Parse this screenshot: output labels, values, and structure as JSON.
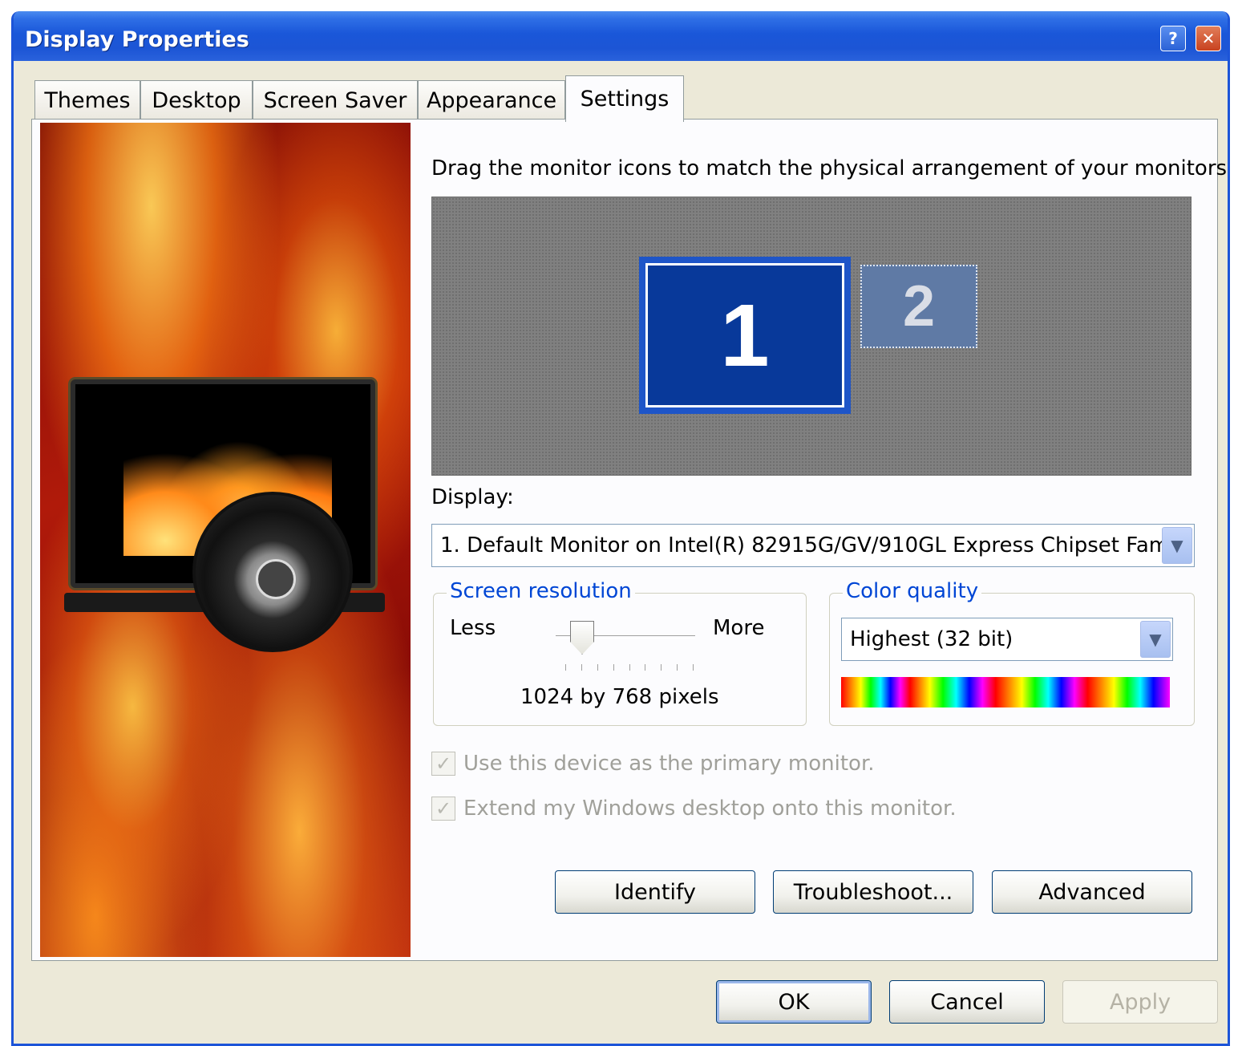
{
  "window": {
    "title": "Display Properties",
    "help_label": "?",
    "close_label": "✕"
  },
  "tabs": [
    {
      "label": "Themes"
    },
    {
      "label": "Desktop"
    },
    {
      "label": "Screen Saver"
    },
    {
      "label": "Appearance"
    },
    {
      "label": "Settings"
    }
  ],
  "active_tab": "Settings",
  "settings": {
    "instruction": "Drag the monitor icons to match the physical arrangement of your monitors.",
    "monitors": [
      {
        "number": "1",
        "selected": true
      },
      {
        "number": "2",
        "selected": false
      }
    ],
    "display_label": "Display:",
    "display_value": "1. Default Monitor on Intel(R) 82915G/GV/910GL Express Chipset Fam",
    "resolution": {
      "title": "Screen resolution",
      "less": "Less",
      "more": "More",
      "value": "1024 by 768 pixels",
      "slider_fraction": 0.2
    },
    "color_quality": {
      "title": "Color quality",
      "value": "Highest (32 bit)"
    },
    "checkboxes": [
      {
        "label": "Use this device as the primary monitor.",
        "checked": true,
        "enabled": false
      },
      {
        "label": "Extend my Windows desktop onto this monitor.",
        "checked": true,
        "enabled": false
      }
    ],
    "buttons": {
      "identify": "Identify",
      "troubleshoot": "Troubleshoot...",
      "advanced": "Advanced"
    }
  },
  "footer": {
    "ok": "OK",
    "cancel": "Cancel",
    "apply": "Apply"
  },
  "colors": {
    "title_blue": "#1a57d9",
    "group_title": "#0046d5",
    "monitor_selected": "#08399a"
  },
  "icons": {
    "dropdown": "chevron-down-icon",
    "check": "check-icon"
  }
}
